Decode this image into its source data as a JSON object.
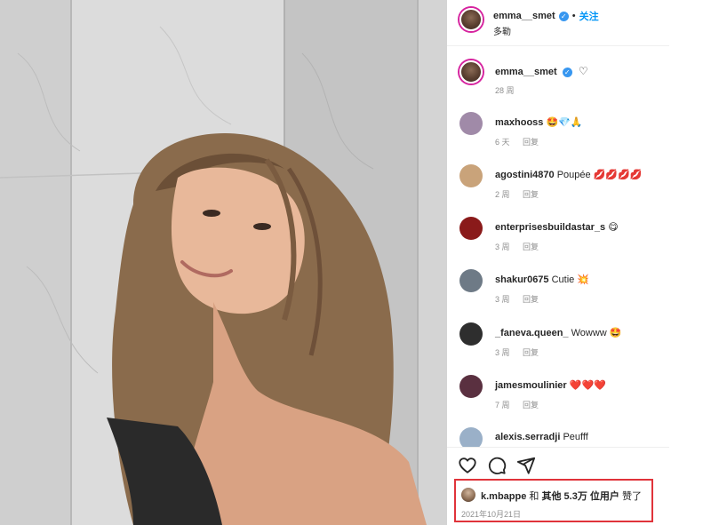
{
  "photo": {
    "alt_icon": "portrait-photo"
  },
  "header": {
    "username": "emma__smet",
    "verified": true,
    "separator": "•",
    "follow_label": "关注",
    "subtitle": "多勒"
  },
  "caption": {
    "username": "emma__smet",
    "time": "28 周"
  },
  "comments": [
    {
      "username": "maxhooss",
      "text": "🤩💎🙏",
      "time": "6 天",
      "reply": "回复",
      "avatar_color": "#a08aa8"
    },
    {
      "username": "agostini4870",
      "text": "Poupée 💋💋💋💋",
      "time": "2 周",
      "reply": "回复",
      "avatar_color": "#c9a37a"
    },
    {
      "username": "enterprisesbuildastar_s",
      "text": "😋",
      "time": "3 周",
      "reply": "回复",
      "avatar_color": "#8a1a1a"
    },
    {
      "username": "shakur0675",
      "text": "Cutie 💥",
      "time": "3 周",
      "reply": "回复",
      "avatar_color": "#6e7a86"
    },
    {
      "username": "_faneva.queen_",
      "text": "Wowww 🤩",
      "time": "3 周",
      "reply": "回复",
      "avatar_color": "#2e2e2e"
    },
    {
      "username": "jamesmoulinier",
      "text": "❤️❤️❤️",
      "time": "7 周",
      "reply": "回复",
      "avatar_color": "#5a3040"
    },
    {
      "username": "alexis.serradji",
      "text": "Peufff",
      "time": "",
      "reply": "",
      "avatar_color": "#9ab0c8"
    }
  ],
  "actions": {
    "like_icon": "heart-icon",
    "comment_icon": "comment-icon",
    "share_icon": "share-icon"
  },
  "likes": {
    "first_user": "k.mbappe",
    "connector": "和",
    "others": "其他 5.3万 位用户",
    "suffix": "赞了",
    "date": "2021年10月21日"
  },
  "colors": {
    "follow": "#0095f6",
    "verified": "#3897f0",
    "highlight_box": "#e0333a",
    "muted_text": "#8e8e8e"
  }
}
